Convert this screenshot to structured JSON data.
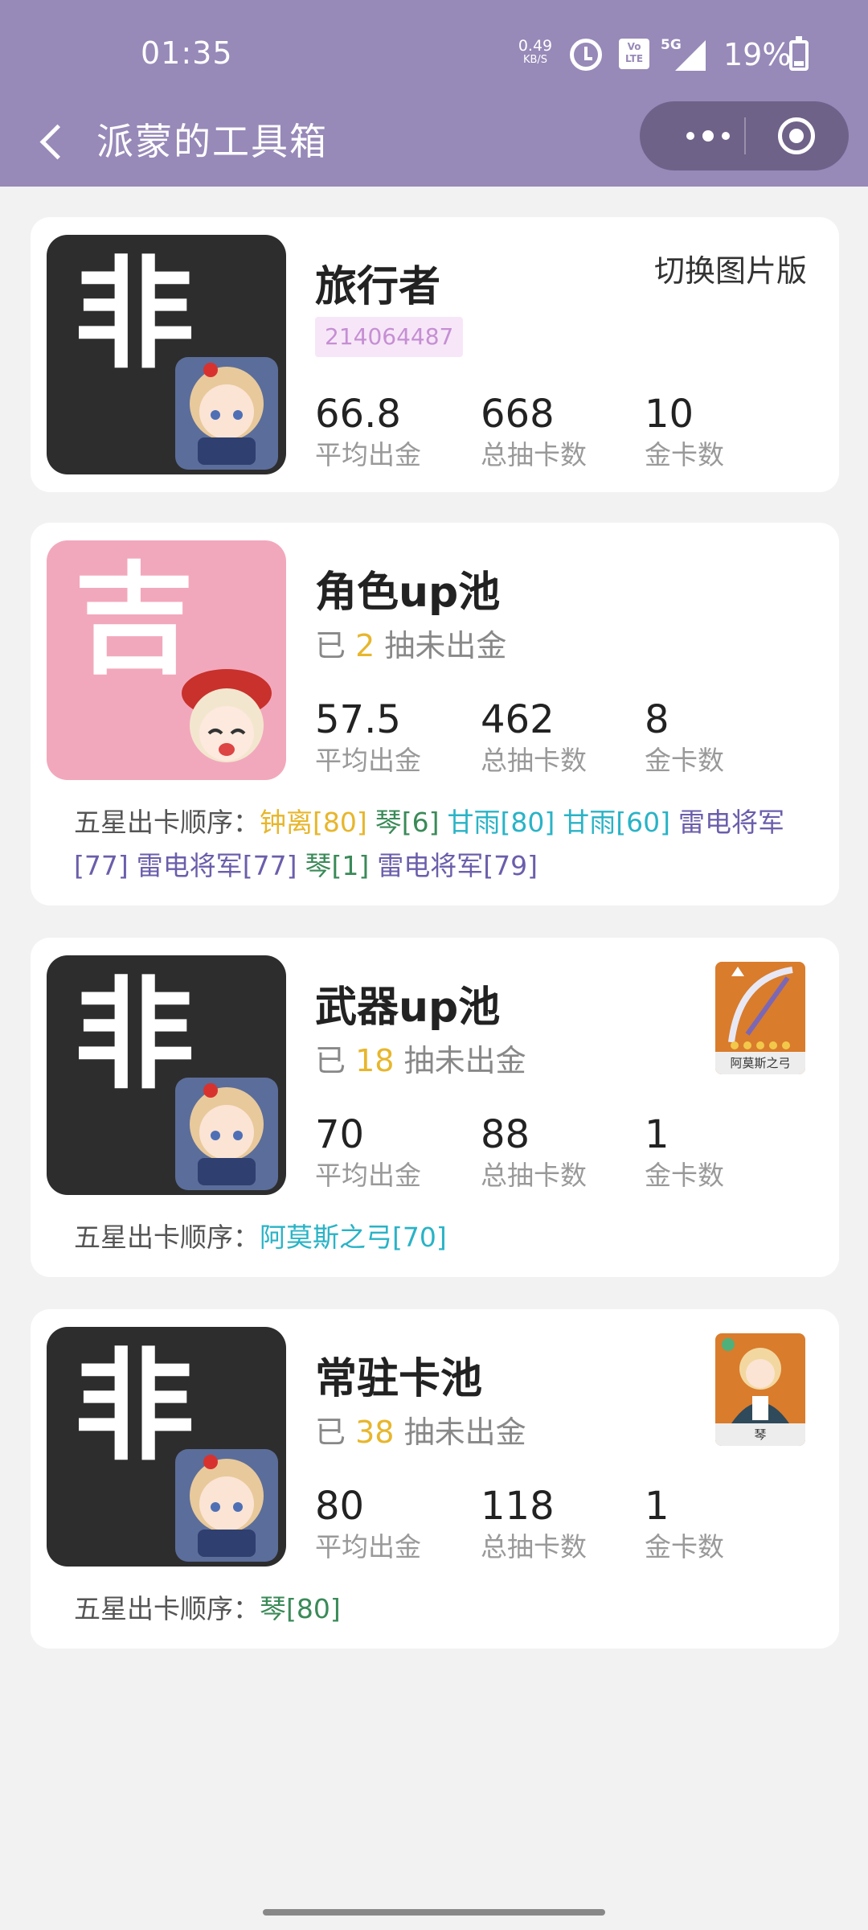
{
  "status_bar": {
    "time": "01:35",
    "net_speed": "0.49",
    "net_unit": "KB/S",
    "volte": "Vo LTE",
    "signal_type": "5G",
    "battery": "19%"
  },
  "header": {
    "title": "派蒙的工具箱",
    "colors": {
      "bar": "#9789b8",
      "capsule": "#6f6289"
    }
  },
  "profile": {
    "avatar_glyph": "非",
    "name": "旅行者",
    "uid": "214064487",
    "switch_label": "切换图片版",
    "stats": [
      {
        "value": "66.8",
        "label": "平均出金"
      },
      {
        "value": "668",
        "label": "总抽卡数"
      },
      {
        "value": "10",
        "label": "金卡数"
      }
    ]
  },
  "pools": [
    {
      "avatar_glyph": "吉",
      "avatar_style": "pink",
      "title": "角色up池",
      "pity_prefix": "已",
      "pity_count": "2",
      "pity_suffix": "抽未出金",
      "stats": [
        {
          "value": "57.5",
          "label": "平均出金"
        },
        {
          "value": "462",
          "label": "总抽卡数"
        },
        {
          "value": "8",
          "label": "金卡数"
        }
      ],
      "order_label": "五星出卡顺序：",
      "order": [
        {
          "text": "钟离[80]",
          "color": "yellow"
        },
        {
          "text": "琴[6]",
          "color": "green"
        },
        {
          "text": "甘雨[80]",
          "color": "cyan"
        },
        {
          "text": "甘雨[60]",
          "color": "cyan"
        },
        {
          "text": "雷电将军[77]",
          "color": "purple"
        },
        {
          "text": "雷电将军[77]",
          "color": "purple"
        },
        {
          "text": "琴[1]",
          "color": "green"
        },
        {
          "text": "雷电将军[79]",
          "color": "purple"
        }
      ]
    },
    {
      "avatar_glyph": "非",
      "avatar_style": "dark",
      "title": "武器up池",
      "pity_prefix": "已",
      "pity_count": "18",
      "pity_suffix": "抽未出金",
      "thumb_name": "阿莫斯之弓",
      "stats": [
        {
          "value": "70",
          "label": "平均出金"
        },
        {
          "value": "88",
          "label": "总抽卡数"
        },
        {
          "value": "1",
          "label": "金卡数"
        }
      ],
      "order_label": "五星出卡顺序：",
      "order": [
        {
          "text": "阿莫斯之弓[70]",
          "color": "cyan"
        }
      ]
    },
    {
      "avatar_glyph": "非",
      "avatar_style": "dark",
      "title": "常驻卡池",
      "pity_prefix": "已",
      "pity_count": "38",
      "pity_suffix": "抽未出金",
      "thumb_name": "琴",
      "stats": [
        {
          "value": "80",
          "label": "平均出金"
        },
        {
          "value": "118",
          "label": "总抽卡数"
        },
        {
          "value": "1",
          "label": "金卡数"
        }
      ],
      "order_label": "五星出卡顺序：",
      "order": [
        {
          "text": "琴[80]",
          "color": "green"
        }
      ]
    }
  ],
  "colors": {
    "yellow": "#e7b62c",
    "green": "#3a8a58",
    "cyan": "#29b3c6",
    "purple": "#6b5eab",
    "uid_badge_bg": "#f7e6f8",
    "uid_badge_text": "#c58fd3"
  }
}
